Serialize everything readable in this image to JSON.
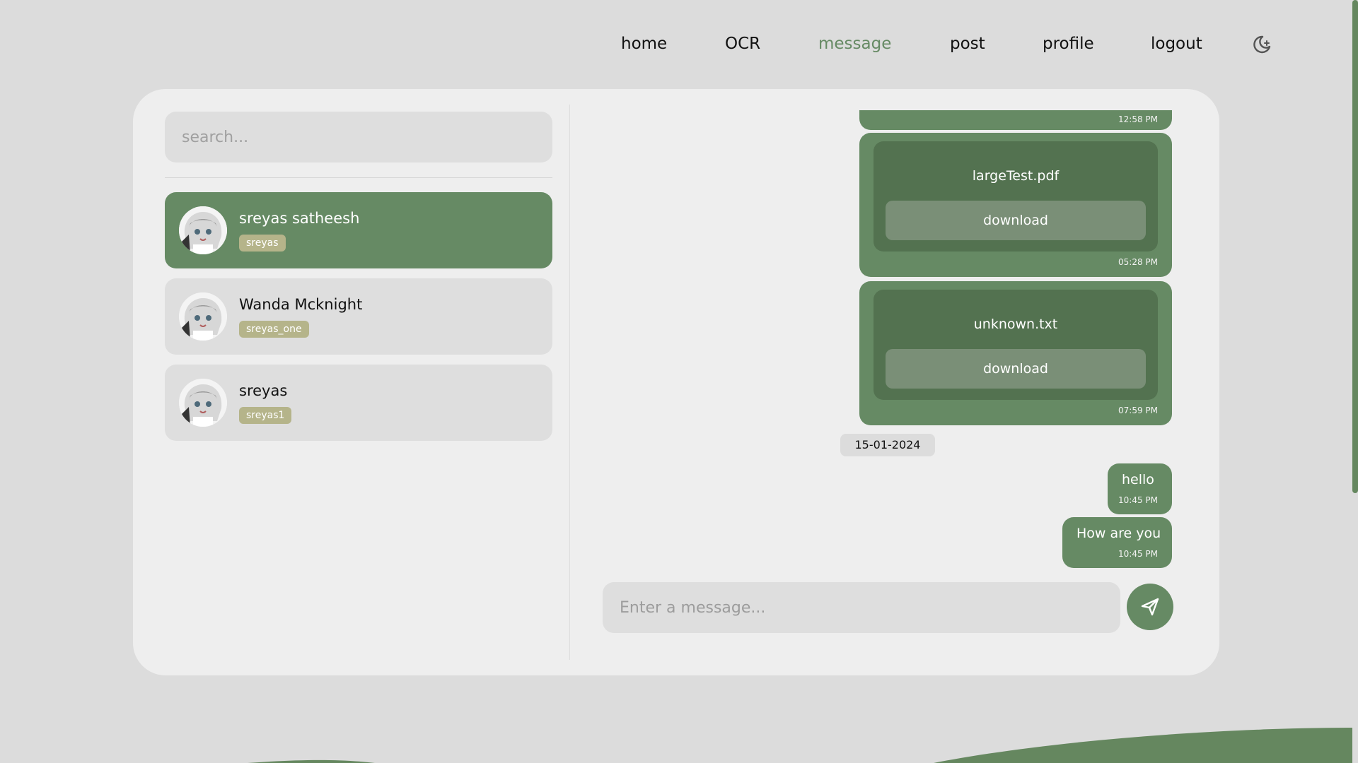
{
  "nav": {
    "items": [
      {
        "label": "home",
        "active": false
      },
      {
        "label": "OCR",
        "active": false
      },
      {
        "label": "message",
        "active": true
      },
      {
        "label": "post",
        "active": false
      },
      {
        "label": "profile",
        "active": false
      },
      {
        "label": "logout",
        "active": false
      }
    ],
    "theme_icon": "moon-icon"
  },
  "sidebar": {
    "search_placeholder": "search...",
    "contacts": [
      {
        "name": "sreyas satheesh",
        "username": "sreyas",
        "active": true
      },
      {
        "name": "Wanda Mcknight",
        "username": "sreyas_one",
        "active": false
      },
      {
        "name": "sreyas",
        "username": "sreyas1",
        "active": false
      }
    ]
  },
  "chat": {
    "partial_message": {
      "time": "12:58 PM"
    },
    "files": [
      {
        "filename": "largeTest.pdf",
        "button": "download",
        "time": "05:28 PM"
      },
      {
        "filename": "unknown.txt",
        "button": "download",
        "time": "07:59 PM"
      }
    ],
    "date_separator": "15-01-2024",
    "messages": [
      {
        "text": "hello",
        "time": "10:45 PM"
      },
      {
        "text": "How are you",
        "time": "10:45 PM"
      }
    ],
    "input_placeholder": "Enter a message...",
    "send_icon": "send-icon"
  },
  "colors": {
    "accent": "#668a64",
    "file_inner": "#537250",
    "badge": "#b5b48a",
    "background": "#dcdcdc",
    "card": "#eeeeee"
  }
}
